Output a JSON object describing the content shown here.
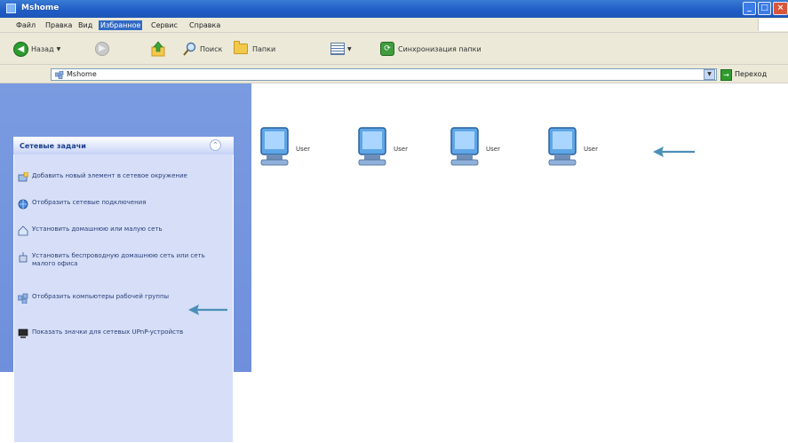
{
  "window": {
    "title": "Mshome"
  },
  "menu": {
    "items": [
      "Файл",
      "Правка",
      "Вид",
      "Избранное",
      "Сервис",
      "Справка"
    ],
    "active_index": 3
  },
  "toolbar": {
    "back_label": "Назад",
    "search_label": "Поиск",
    "folders_label": "Папки",
    "sync_label": "Синхронизация папки"
  },
  "address": {
    "value": "Mshome",
    "go_label": "Переход"
  },
  "tasks_panel": {
    "title": "Сетевые задачи",
    "items": [
      {
        "icon": "add-network-place-icon",
        "label": "Добавить новый элемент в сетевое окружение"
      },
      {
        "icon": "network-connections-icon",
        "label": "Отобразить сетевые подключения"
      },
      {
        "icon": "home-network-icon",
        "label": "Установить домашнюю или малую сеть"
      },
      {
        "icon": "wireless-network-icon",
        "label": "Установить беспроводную домашнюю сеть или сеть малого офиса"
      },
      {
        "icon": "workgroup-computers-icon",
        "label": "Отобразить компьютеры рабочей группы"
      },
      {
        "icon": "upnp-devices-icon",
        "label": "Показать значки для сетевых UPnP-устройств"
      }
    ]
  },
  "computers": [
    {
      "label": "User"
    },
    {
      "label": "User"
    },
    {
      "label": "User"
    },
    {
      "label": "User"
    }
  ],
  "colors": {
    "titlebar": "#1f5cc4",
    "chrome": "#ece9d8",
    "task_panel": "#d6dff7",
    "arrow": "#4a8fb8"
  }
}
